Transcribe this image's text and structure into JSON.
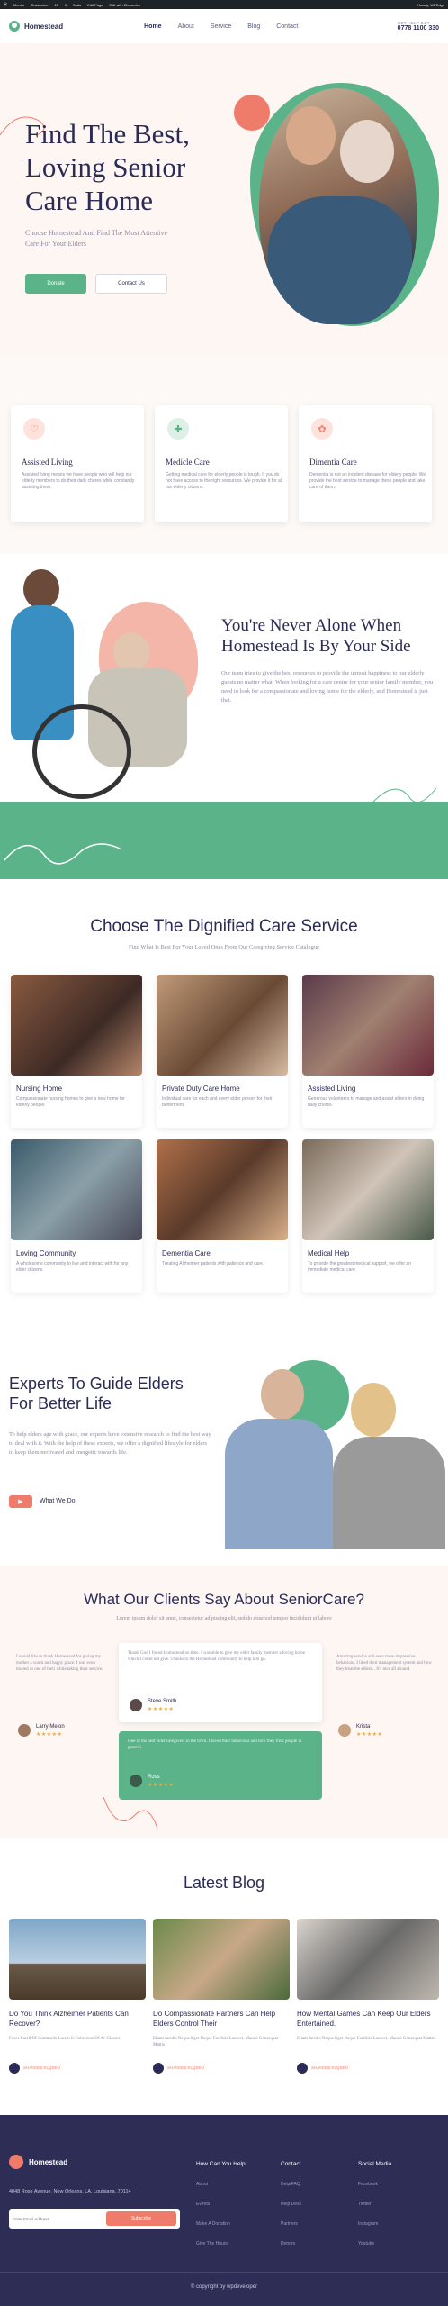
{
  "wp_bar": {
    "items": [
      "Mentor",
      "Customize",
      "Stats",
      "Edit Page",
      "Edit with Elementor"
    ],
    "count_a": "15",
    "count_b": "0",
    "greeting": "Howdy, WPEdge"
  },
  "nav": {
    "brand": "Homestead",
    "links": [
      "Home",
      "About",
      "Service",
      "Blog",
      "Contact"
    ],
    "help_label": "GET HELP 24/7",
    "help_phone": "0778 1100 330"
  },
  "hero": {
    "title_l1": "Find The Best,",
    "title_l2": "Loving Senior",
    "title_l3": "Care Home",
    "subtitle_l1": "Choose Homestead And Find The Most Attentive",
    "subtitle_l2": "Care For Your Elders",
    "donate": "Donate",
    "contact": "Contact Us"
  },
  "features": [
    {
      "title": "Assisted Living",
      "text": "Assisted living means we have people who will help our elderly members to do their daily chores while constantly assisting them."
    },
    {
      "title": "Medicle Care",
      "text": "Getting medical care for elderly people is tough. If you do not have access to the right resources. We provide it for all our elderly citizens."
    },
    {
      "title": "Dimentia Care",
      "text": "Dementia is not an indolent disease for elderly people. We provide the best service to manage these people and take care of them."
    }
  ],
  "about": {
    "title_l1": "You're Never Alone When",
    "title_l2": "Homestead Is By Your Side",
    "text": "Our team tries to give the best resources to provide the utmost happiness to our elderly guests no matter what. When looking for a care centre for your senior family member, you need to look for a compassionate and loving home for the elderly, and Homestead is just that."
  },
  "services": {
    "title": "Choose The Dignified Care Service",
    "subtitle": "Find What Is Best For Your Loved Ones From Our Caregiving Service Catalogue",
    "items": [
      {
        "title": "Nursing Home",
        "text": "Compassionate nursing homes to give a new home for elderly people."
      },
      {
        "title": "Private Duty Care Home",
        "text": "Individual care for each and every elder person for their betterment."
      },
      {
        "title": "Assisted Living",
        "text": "Generous volunteers to manage and assist elders in doing daily chores."
      },
      {
        "title": "Loving Community",
        "text": "A wholesome community to live and interact with for any elder citizens."
      },
      {
        "title": "Dementia Care",
        "text": "Treating Alzheimer patients with patience and care."
      },
      {
        "title": "Medical Help",
        "text": "To provide the greatest medical support, we offer an immediate medical care."
      }
    ]
  },
  "experts": {
    "title_l1": "Experts To Guide Elders",
    "title_l2": "For Better Life",
    "text": "To help elders age with grace, our experts have extensive research to find the best way to deal with it. With the help of these experts, we offer a dignified lifestyle for elders to keep them motivated and energetic towards life.",
    "video_label": "What We Do"
  },
  "testimonials": {
    "title": "What Our Clients Say About SeniorCare?",
    "subtitle": "Lorem ipsum dolor sit amet, consectetur adipiscing elit, sed do eiusmod tempor incididunt ut labore",
    "items": [
      {
        "quote": "I would like to thank Homestead for giving my mother a warm and happy place. I was even treated as one of their while taking their service.",
        "name": "Larry Melon",
        "stars": "★★★★★"
      },
      {
        "quote": "Thank God I found Homestead on time. I was able to give my elder family member a loving home which I could not give. Thanks to the Homestead community to help him go.",
        "name": "Steve Smith",
        "stars": "★★★★★"
      },
      {
        "quote": "Amazing service and even more impressive behaviour. I liked their management system and how they treat the elders... It's nice all around.",
        "name": "Krista",
        "stars": "★★★★★"
      },
      {
        "quote": "One of the best elder caregivers in the town. I loved their behaviour and how they treat people in general.",
        "name": "Ross",
        "stars": "★★★★★"
      }
    ]
  },
  "blog": {
    "title": "Latest Blog",
    "posts": [
      {
        "title": "Do You Think Alzheimer Patients Can Recover?",
        "excerpt": "Fusce Facili Of Commodo Lorem Is Solicitous Of Ac Classes",
        "author": "SHAKEEB ELQSEN"
      },
      {
        "title": "Do Compassionate Partners Can Help Elders Control Their",
        "excerpt": "Etiam Iaculis Neque Eget Neque Facilisis Laoreet. Mauris Consequat Mattis",
        "author": "SHAKEEB ELQSEN"
      },
      {
        "title": "How Mental Games Can Keep Our Elders Entertained.",
        "excerpt": "Etiam Iaculis Neque Eget Neque Facilisis Laoreet. Mauris Consequat Mattis",
        "author": "SHAKEEB ELQSEN"
      }
    ]
  },
  "footer": {
    "brand": "Homestead",
    "address": "4048 Rose Avenue, New Orleans, LA, Louisiana, 70114",
    "email_placeholder": "Enter Email Address",
    "subscribe": "Subscribe",
    "col1_title": "How Can You Help",
    "col1": [
      "About",
      "Events",
      "Make A Donation",
      "Give The Hours"
    ],
    "col2_title": "Contact",
    "col2": [
      "Help/FAQ",
      "Help Desk",
      "Partners",
      "Donors"
    ],
    "col3_title": "Social Media",
    "col3": [
      "Facebook",
      "Twitter",
      "Instagram",
      "Youtube"
    ],
    "copyright": "© copyright by wpdeveloper"
  },
  "colors": {
    "accent": "#5bb38a",
    "coral": "#ef7b6b",
    "navy": "#2b2b55",
    "footer": "#2d2d55"
  }
}
